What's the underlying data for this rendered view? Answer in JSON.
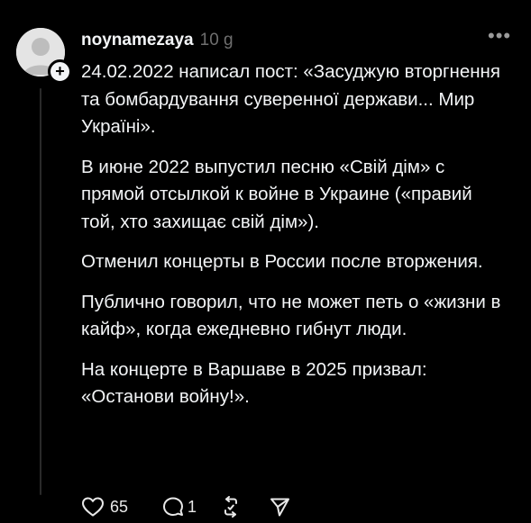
{
  "post": {
    "author": "noynamezaya",
    "time": "10 g",
    "paragraphs": [
      "24.02.2022 написал пост: «Засуджую вторгнення та бомбардування суверенної держави... Мир Україні».",
      "В июне 2022 выпустил песню «Свій дім» с прямой отсылкой к войне в Украине («правий той, хто захищає свій дім»).",
      "Отменил концерты в России после вторжения.",
      "Публично говорил, что не может петь о «жизни в кайф», когда ежедневно гибнут люди.",
      "На концерте в Варшаве в 2025 призвал: «Останови войну!»."
    ],
    "likes": "65",
    "replies": "1"
  },
  "icons": {
    "avatar": "default-avatar-icon",
    "follow": "plus-icon",
    "more": "more-horizontal-icon",
    "like": "heart-icon",
    "reply": "comment-icon",
    "repost": "repost-icon",
    "share": "send-icon"
  },
  "colors": {
    "background": "#000000",
    "text": "#f3f5f7",
    "muted": "#6f6f6f",
    "thread_line": "#2a2a2a"
  }
}
